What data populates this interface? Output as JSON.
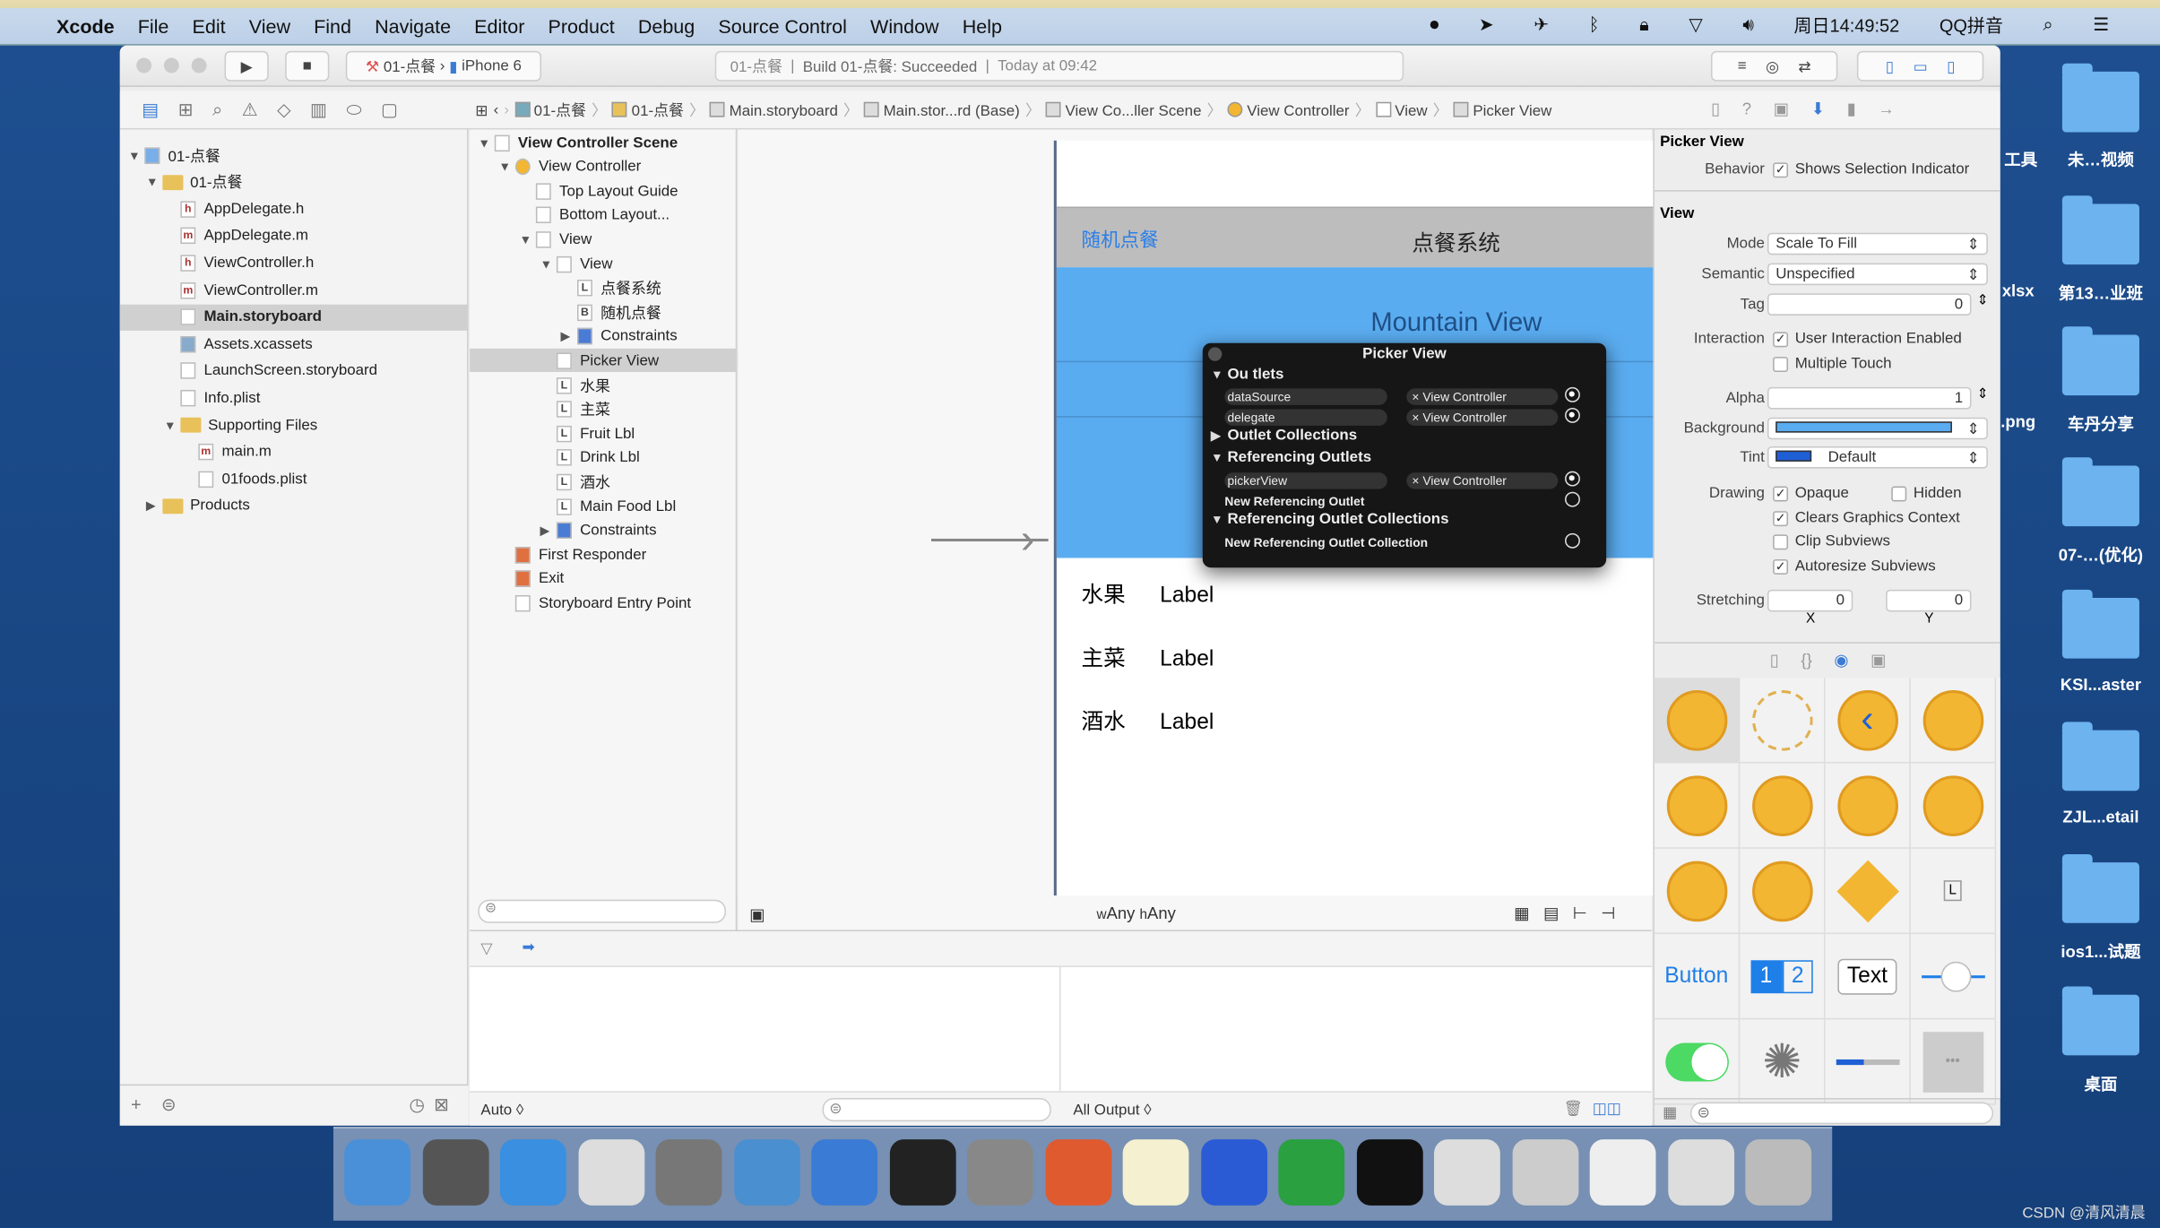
{
  "menubar": {
    "app": "Xcode",
    "items": [
      "File",
      "Edit",
      "View",
      "Find",
      "Navigate",
      "Editor",
      "Product",
      "Debug",
      "Source Control",
      "Window",
      "Help"
    ],
    "clock": "周日14:49:52",
    "input_method": "QQ拼音"
  },
  "toolbar": {
    "scheme": "01-点餐",
    "device": "iPhone 6",
    "activity_project": "01-点餐",
    "activity_build": "Build 01-点餐: Succeeded",
    "activity_time": "Today at 09:42"
  },
  "breadcrumb": [
    "01-点餐",
    "01-点餐",
    "Main.storyboard",
    "Main.stor...rd (Base)",
    "View Co...ller Scene",
    "View Controller",
    "View",
    "Picker View"
  ],
  "navigator": {
    "items": [
      {
        "label": "01-点餐",
        "kind": "project",
        "depth": 0
      },
      {
        "label": "01-点餐",
        "kind": "folder",
        "depth": 1
      },
      {
        "label": "AppDelegate.h",
        "kind": "h",
        "depth": 2
      },
      {
        "label": "AppDelegate.m",
        "kind": "m",
        "depth": 2
      },
      {
        "label": "ViewController.h",
        "kind": "h",
        "depth": 2
      },
      {
        "label": "ViewController.m",
        "kind": "m",
        "depth": 2
      },
      {
        "label": "Main.storyboard",
        "kind": "storyboard",
        "depth": 2,
        "selected": true
      },
      {
        "label": "Assets.xcassets",
        "kind": "assets",
        "depth": 2
      },
      {
        "label": "LaunchScreen.storyboard",
        "kind": "storyboard",
        "depth": 2
      },
      {
        "label": "Info.plist",
        "kind": "plist",
        "depth": 2
      },
      {
        "label": "Supporting Files",
        "kind": "folder",
        "depth": 2
      },
      {
        "label": "main.m",
        "kind": "m",
        "depth": 3
      },
      {
        "label": "01foods.plist",
        "kind": "plist",
        "depth": 3
      },
      {
        "label": "Products",
        "kind": "folder",
        "depth": 1
      }
    ]
  },
  "outline": {
    "items": [
      {
        "label": "View Controller Scene",
        "depth": 0,
        "bold": true
      },
      {
        "label": "View Controller",
        "depth": 1
      },
      {
        "label": "Top Layout Guide",
        "depth": 2
      },
      {
        "label": "Bottom Layout...",
        "depth": 2
      },
      {
        "label": "View",
        "depth": 2
      },
      {
        "label": "View",
        "depth": 3
      },
      {
        "label": "点餐系统",
        "depth": 4,
        "badge": "L"
      },
      {
        "label": "随机点餐",
        "depth": 4,
        "badge": "B"
      },
      {
        "label": "Constraints",
        "depth": 4
      },
      {
        "label": "Picker View",
        "depth": 3,
        "selected": true
      },
      {
        "label": "水果",
        "depth": 3,
        "badge": "L"
      },
      {
        "label": "主菜",
        "depth": 3,
        "badge": "L"
      },
      {
        "label": "Fruit Lbl",
        "depth": 3,
        "badge": "L"
      },
      {
        "label": "Drink Lbl",
        "depth": 3,
        "badge": "L"
      },
      {
        "label": "酒水",
        "depth": 3,
        "badge": "L"
      },
      {
        "label": "Main Food Lbl",
        "depth": 3,
        "badge": "L"
      },
      {
        "label": "Constraints",
        "depth": 3
      },
      {
        "label": "First Responder",
        "depth": 1
      },
      {
        "label": "Exit",
        "depth": 1
      },
      {
        "label": "Storyboard Entry Point",
        "depth": 1
      }
    ]
  },
  "scene": {
    "random_button": "随机点餐",
    "title": "点餐系统",
    "picker_sample": "Mountain View",
    "rows": [
      {
        "name": "水果",
        "value": "Label"
      },
      {
        "name": "主菜",
        "value": "Label"
      },
      {
        "name": "酒水",
        "value": "Label"
      }
    ],
    "size_class_w": "Any",
    "size_class_h": "Any",
    "size_w_prefix": "w",
    "size_h_prefix": "h",
    "picker_color": "#5aacf0"
  },
  "popover": {
    "title": "Picker View",
    "outlets_header": "Ou tlets",
    "outlets": [
      {
        "name": "dataSource",
        "target": "View Controller"
      },
      {
        "name": "delegate",
        "target": "View Controller"
      }
    ],
    "outlet_collections": "Outlet Collections",
    "referencing_outlets": "Referencing Outlets",
    "ref_outlets": [
      {
        "name": "pickerView",
        "target": "View Controller"
      }
    ],
    "new_ref_outlet": "New Referencing Outlet",
    "ref_outlet_collections": "Referencing Outlet Collections",
    "new_ref_collection": "New Referencing Outlet Collection"
  },
  "inspector": {
    "section1": "Picker View",
    "behavior_label": "Behavior",
    "shows_selection": "Shows Selection Indicator",
    "section2": "View",
    "mode_label": "Mode",
    "mode": "Scale To Fill",
    "semantic_label": "Semantic",
    "semantic": "Unspecified",
    "tag_label": "Tag",
    "tag": "0",
    "interaction_label": "Interaction",
    "user_interaction": "User Interaction Enabled",
    "multiple_touch": "Multiple Touch",
    "alpha_label": "Alpha",
    "alpha": "1",
    "background_label": "Background",
    "tint_label": "Tint",
    "tint": "Default",
    "drawing_label": "Drawing",
    "opaque": "Opaque",
    "hidden": "Hidden",
    "clears": "Clears Graphics Context",
    "clip": "Clip Subviews",
    "autoresize": "Autoresize Subviews",
    "stretching_label": "Stretching",
    "stretch_x": "0",
    "stretch_y": "0",
    "x_label": "X",
    "y_label": "Y",
    "tint_color": "#1f5fd6"
  },
  "library": {
    "button": "Button",
    "seg1": "1",
    "seg2": "2",
    "text": "Text",
    "label": "L"
  },
  "debug": {
    "auto": "Auto ◊",
    "output": "All Output ◊"
  },
  "desktop": [
    "工具",
    "未…视频",
    "xlsx",
    "第13…业班",
    ".png",
    "车丹分享",
    "07-…(优化)",
    "KSI...aster",
    "ZJL...etail",
    "ios1...试题",
    "桌面"
  ],
  "watermark": "CSDN @清风清晨"
}
